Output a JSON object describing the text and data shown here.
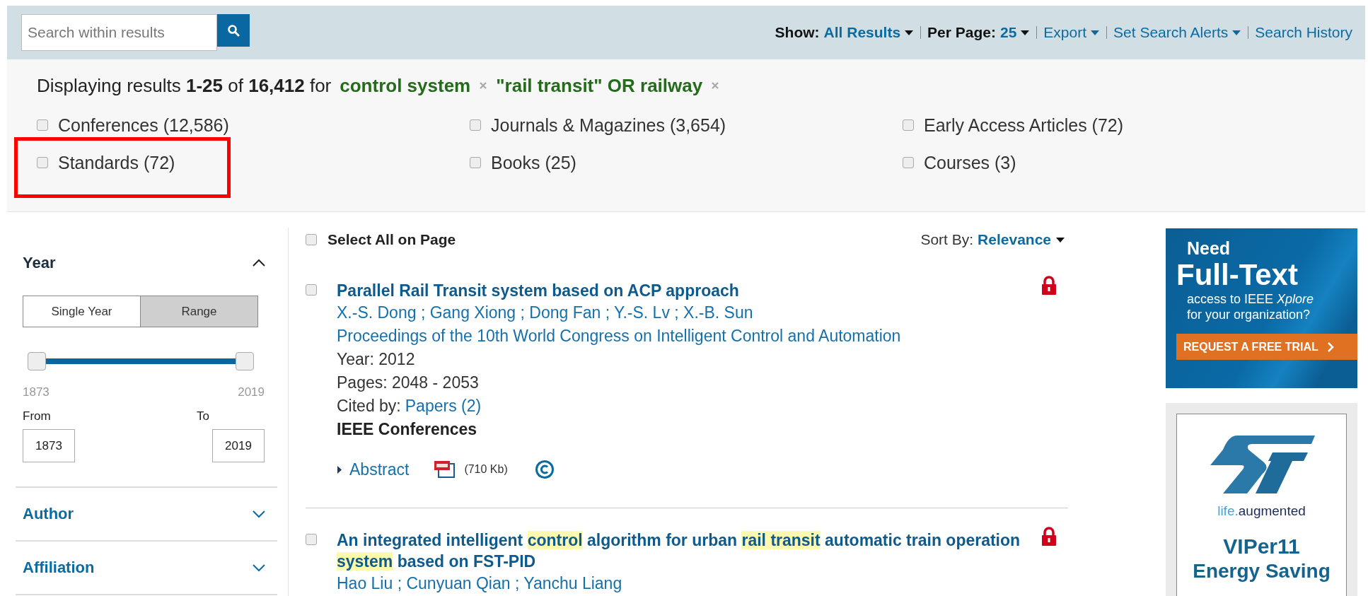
{
  "search": {
    "placeholder": "Search within results"
  },
  "toolbar": [
    {
      "label": "Show:",
      "value": "All Results",
      "dropdown": true
    },
    {
      "label": "Per Page:",
      "value": "25",
      "dropdown": true
    },
    {
      "value": "Export",
      "dropdown": true
    },
    {
      "value": "Set Search Alerts",
      "dropdown": true
    },
    {
      "value": "Search History",
      "dropdown": false
    }
  ],
  "summary": "Displaying results **1-25** of **16,412** for",
  "terms": [
    {
      "text": "control system"
    },
    {
      "text": "\"rail transit\" OR railway"
    }
  ],
  "filters": [
    {
      "label": "Conferences (12,586)",
      "checked": false,
      "highlighted": false
    },
    {
      "label": "Journals & Magazines (3,654)",
      "checked": false,
      "highlighted": false
    },
    {
      "label": "Early Access Articles (72)",
      "checked": false,
      "highlighted": false
    },
    {
      "label": "Standards (72)",
      "checked": false,
      "highlighted": true
    },
    {
      "label": "Books (25)",
      "checked": false,
      "highlighted": false
    },
    {
      "label": "Courses (3)",
      "checked": false,
      "highlighted": false
    }
  ],
  "sidebar": {
    "year": {
      "title": "Year",
      "expanded": true,
      "modes": [
        {
          "label": "Single Year",
          "selected": false
        },
        {
          "label": "Range",
          "selected": true
        }
      ],
      "range_start": {
        "level": 0
      },
      "range_end": {
        "level": 1
      },
      "min_label": "1873",
      "max_label": "2019",
      "from": {
        "label": "From",
        "value": "1873"
      },
      "to": {
        "label": "To",
        "value": "2019"
      }
    },
    "sections": [
      {
        "title": "Author",
        "expanded": false
      },
      {
        "title": "Affiliation",
        "expanded": false
      }
    ]
  },
  "results": {
    "select_all": {
      "label": "Select All on Page",
      "checked": false
    },
    "sort": {
      "label": "Sort By:",
      "value": "Relevance"
    },
    "items": [
      {
        "checked": false,
        "locked": true,
        "title": [
          {
            "text": "Parallel Rail Transit system based on ACP approach",
            "highlighted": false
          }
        ],
        "authors": "X.-S. Dong ; Gang Xiong ; Dong Fan ; Y.-S. Lv ; X.-B. Sun",
        "publication": "Proceedings of the 10th World Congress on Intelligent Control and Automation",
        "details": [
          "Year: 2012",
          "Pages: 2048 - 2053"
        ],
        "cited": {
          "label": "Cited by:",
          "link": "Papers (2)"
        },
        "source": "IEEE Conferences",
        "abstract": "Abstract",
        "pdf_size": "(710 Kb)",
        "copyright": true
      },
      {
        "checked": false,
        "locked": true,
        "title": [
          {
            "text": "An integrated intelligent ",
            "highlighted": false
          },
          {
            "text": "control",
            "highlighted": true
          },
          {
            "text": " algorithm for urban ",
            "highlighted": false
          },
          {
            "text": "rail transit",
            "highlighted": true
          },
          {
            "text": " automatic train operation ",
            "highlighted": false
          },
          {
            "text": "system",
            "highlighted": true
          },
          {
            "text": " based on FST-PID",
            "highlighted": false
          }
        ],
        "authors": "Hao Liu ; Cunyuan Qian ; Yanchu Liang"
      }
    ]
  },
  "ads": {
    "trial": {
      "line1": "Need",
      "headline": "Full-Text",
      "body": [
        "access to IEEE *Xplore*",
        "for your organization?"
      ],
      "cta": "REQUEST A FREE TRIAL"
    },
    "sponsor": {
      "tagline": [
        "life.",
        "augmented"
      ],
      "product": "VIPer11",
      "subtitle": "Energy Saving"
    }
  }
}
